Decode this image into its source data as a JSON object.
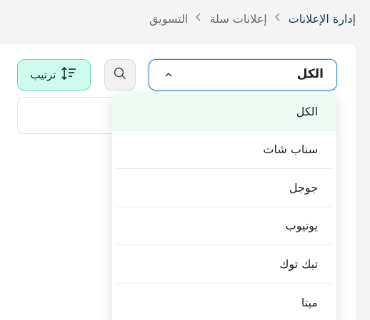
{
  "breadcrumb": {
    "items": [
      "التسويق",
      "إعلانات سلة",
      "إدارة الإعلانات"
    ]
  },
  "filter": {
    "selected_value": "الكل",
    "options": [
      "الكل",
      "سناب شات",
      "جوجل",
      "يوتيوب",
      "تيك توك",
      "ميتا"
    ]
  },
  "sort": {
    "label": "ترتيب"
  },
  "colors": {
    "accent": "#5fdcc1",
    "accent_bg": "#cdfcef",
    "focus_border": "#3b82c4"
  },
  "icons": {
    "search": "search-icon",
    "sort": "sort-icon",
    "caret": "chevron-up-icon"
  }
}
